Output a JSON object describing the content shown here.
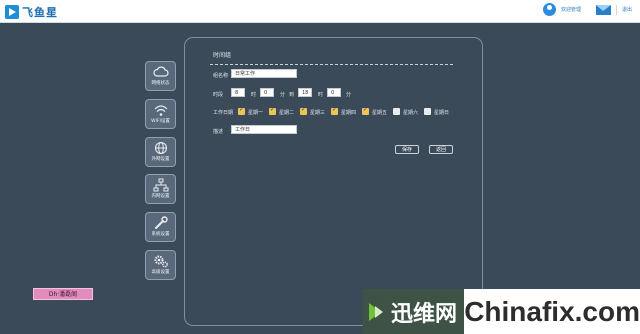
{
  "app": {
    "brand": "飞鱼星"
  },
  "topbar": {
    "user_label": "欢迎管理",
    "logout_label": "退出"
  },
  "sidebar": {
    "items": [
      {
        "label": "网络状态",
        "icon": "cloud-icon"
      },
      {
        "label": "WIFI设置",
        "icon": "wifi-icon"
      },
      {
        "label": "外网设置",
        "icon": "globe-icon"
      },
      {
        "label": "内网设置",
        "icon": "network-icon"
      },
      {
        "label": "系统设置",
        "icon": "wrench-icon"
      },
      {
        "label": "高级设置",
        "icon": "gears-icon"
      }
    ]
  },
  "form": {
    "title": "时间组",
    "name_label": "组名称",
    "name_value": "日常工作",
    "time_label": "时段",
    "start_hour": "8",
    "start_hour_unit": "时",
    "start_min": "0",
    "start_min_unit": "分",
    "to_label": "到",
    "end_hour": "18",
    "end_hour_unit": "时",
    "end_min": "0",
    "end_min_unit": "分",
    "workday_label": "工作日期",
    "days": [
      {
        "label": "星期一",
        "checked": true
      },
      {
        "label": "星期二",
        "checked": true
      },
      {
        "label": "星期三",
        "checked": true
      },
      {
        "label": "星期四",
        "checked": true
      },
      {
        "label": "星期五",
        "checked": true
      },
      {
        "label": "星期六",
        "checked": false
      },
      {
        "label": "星期日",
        "checked": false
      }
    ],
    "desc_label": "描述",
    "desc_value": "工作日",
    "save_label": "保存",
    "back_label": "返回"
  },
  "stamp": {
    "text": "Dh·潘磊阁"
  },
  "watermark": {
    "cn": "迅维网",
    "en": "Chinafix.com"
  },
  "colors": {
    "background": "#3b4a58",
    "checkbox_on": "#f0c35a",
    "accent": "#1c8fd6"
  }
}
